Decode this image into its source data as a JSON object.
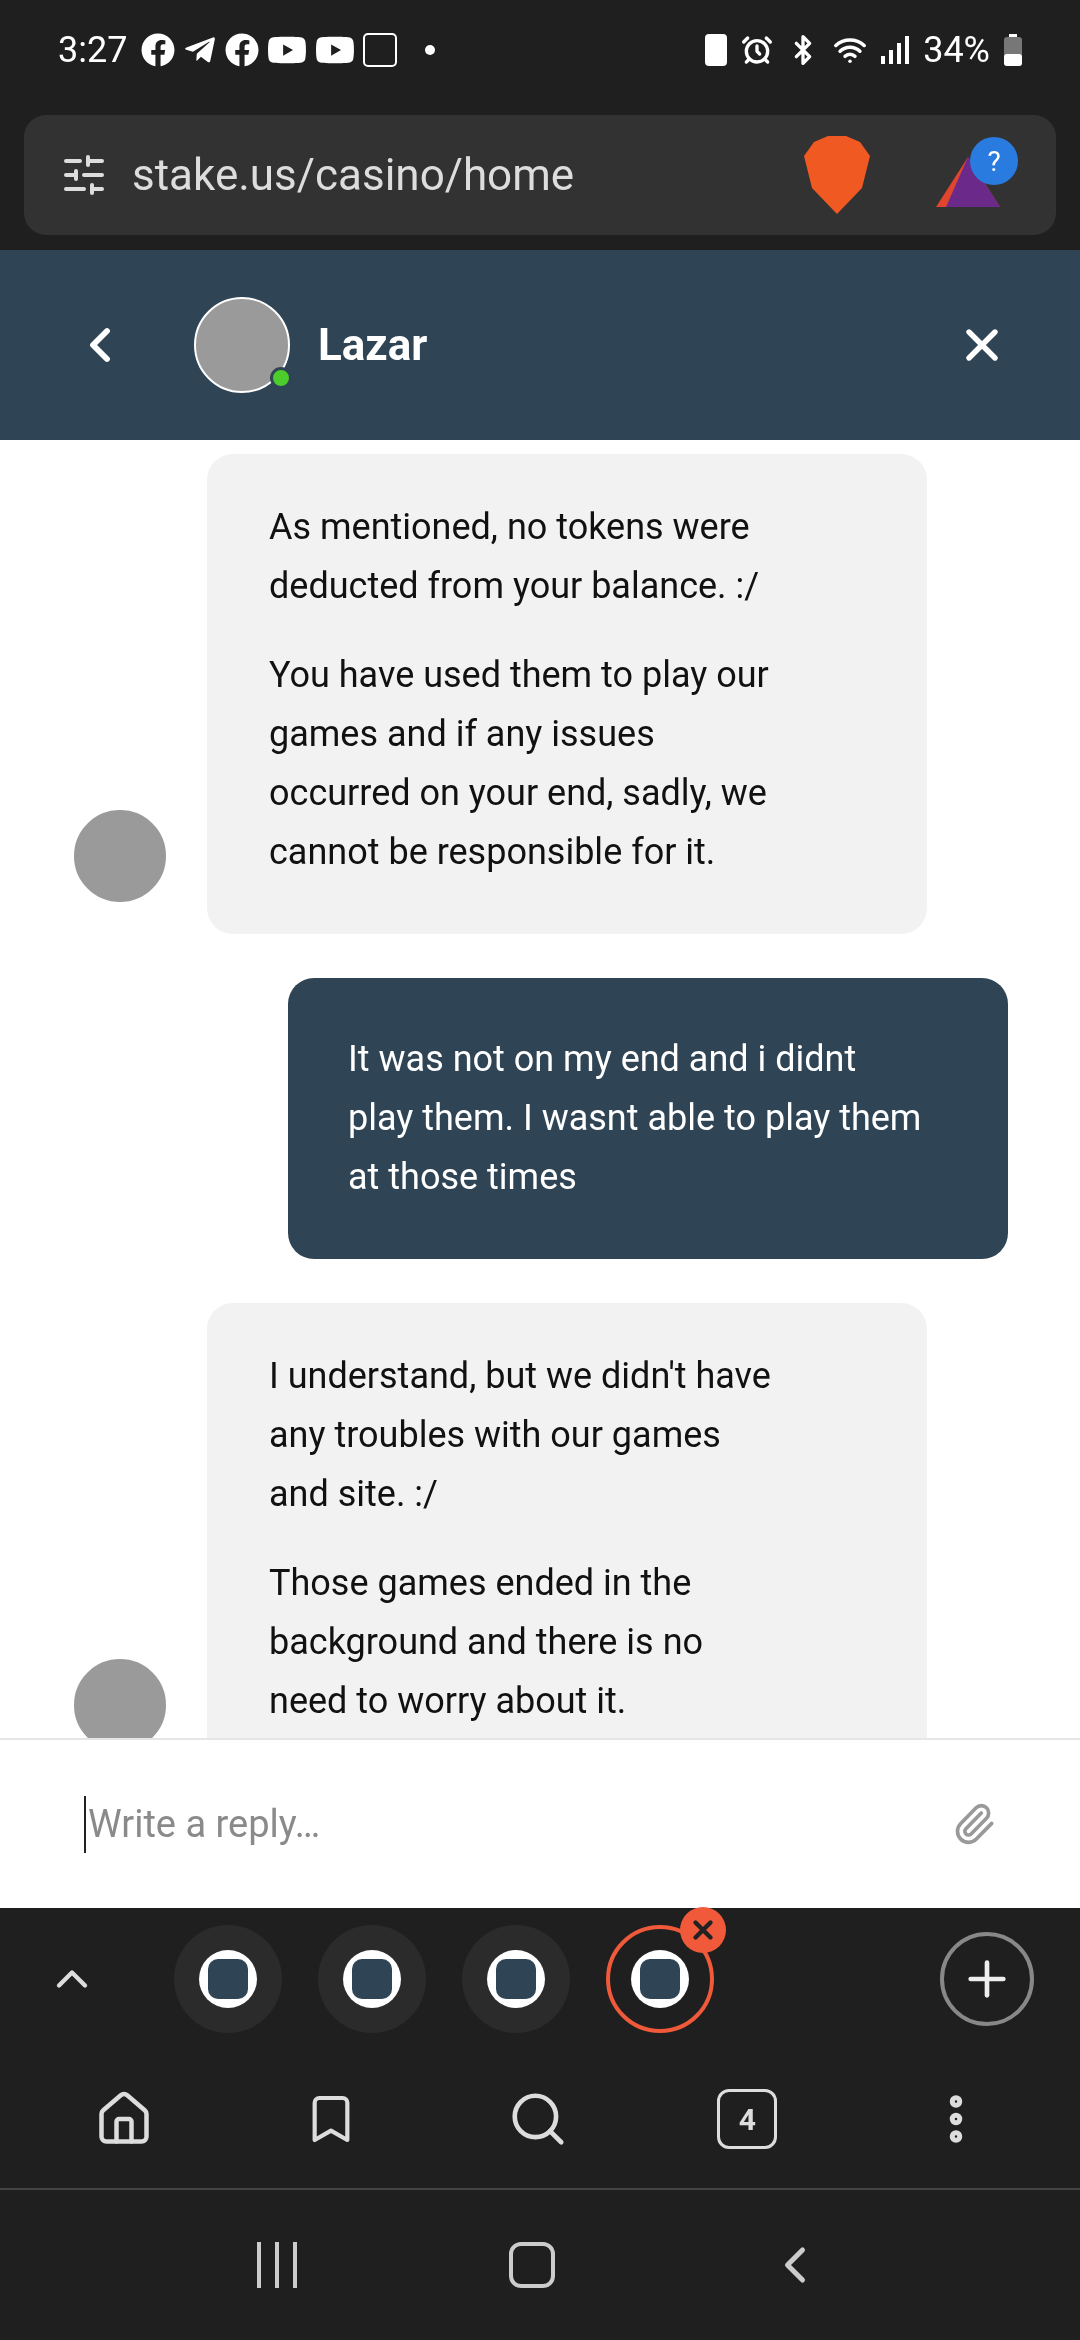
{
  "status_bar": {
    "time": "3:27",
    "battery": "34%"
  },
  "address_bar": {
    "url": "stake.us/casino/home",
    "extension_badge": "?"
  },
  "chat_header": {
    "name": "Lazar",
    "online": true
  },
  "messages": [
    {
      "kind": "agent",
      "avatar": true,
      "paragraphs": [
        "As mentioned, no tokens were deducted from your balance. :/",
        "You have used them to play our games and if any issues occurred on your end, sadly, we cannot be responsible for it."
      ]
    },
    {
      "kind": "user",
      "avatar": false,
      "paragraphs": [
        "It was not on my end and i didnt play them. I wasnt able to play them at those times"
      ]
    },
    {
      "kind": "agent",
      "avatar": true,
      "paragraphs": [
        "I understand, but we didn't have any troubles with our games and site. :/",
        "Those games ended in the background and there is no need to worry about it."
      ]
    }
  ],
  "composer": {
    "placeholder": "Write a reply…"
  },
  "browser_tabs": [
    {
      "selected": false
    },
    {
      "selected": false
    },
    {
      "selected": false
    },
    {
      "selected": true
    }
  ],
  "toolbar": {
    "tab_count": "4"
  }
}
